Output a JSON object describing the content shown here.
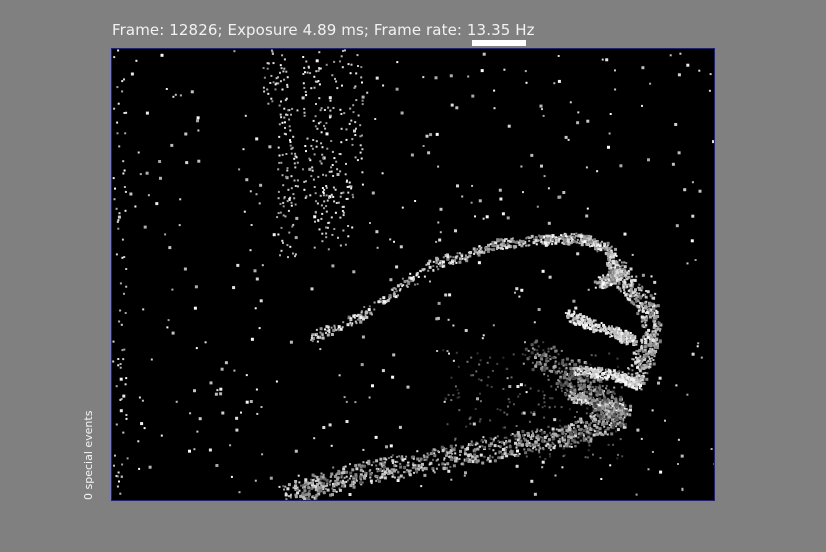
{
  "header": {
    "status": "Frame: 12826; Exposure 4.89 ms; Frame rate: 13.35 Hz"
  },
  "sidebar": {
    "special_events": "0 special events"
  },
  "colors": {
    "background": "#808080",
    "viewer_background": "#000000",
    "viewer_border": "#1a1aa8",
    "text": "#f2f2f2"
  }
}
